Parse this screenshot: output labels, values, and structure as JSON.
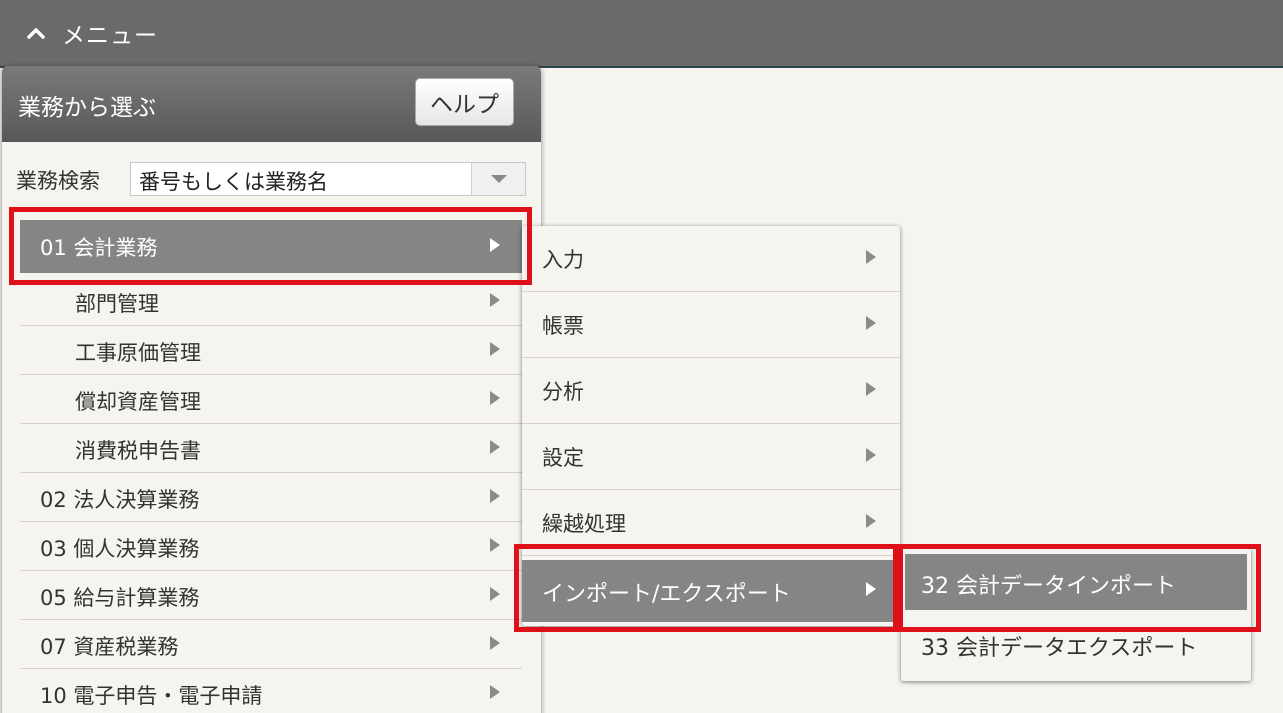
{
  "topbar": {
    "title": "メニュー"
  },
  "panel": {
    "title": "業務から選ぶ",
    "help_label": "ヘルプ",
    "search_label": "業務検索",
    "search_value": "番号もしくは業務名"
  },
  "menu": {
    "items": [
      {
        "label": "01 会計業務"
      },
      {
        "label": "部門管理"
      },
      {
        "label": "工事原価管理"
      },
      {
        "label": "償却資産管理"
      },
      {
        "label": "消費税申告書"
      },
      {
        "label": "02 法人決算業務"
      },
      {
        "label": "03 個人決算業務"
      },
      {
        "label": "05 給与計算業務"
      },
      {
        "label": "07 資産税業務"
      },
      {
        "label": "10 電子申告・電子申請"
      }
    ]
  },
  "submenu": {
    "items": [
      {
        "label": "入力"
      },
      {
        "label": "帳票"
      },
      {
        "label": "分析"
      },
      {
        "label": "設定"
      },
      {
        "label": "繰越処理"
      },
      {
        "label": "インポート/エクスポート"
      }
    ]
  },
  "submenu3": {
    "items": [
      {
        "label": "32 会計データインポート"
      },
      {
        "label": "33 会計データエクスポート"
      }
    ]
  },
  "colors": {
    "highlight": "#e0101a",
    "active_bg": "#858585",
    "topbar_bg": "#6a6a6a"
  }
}
